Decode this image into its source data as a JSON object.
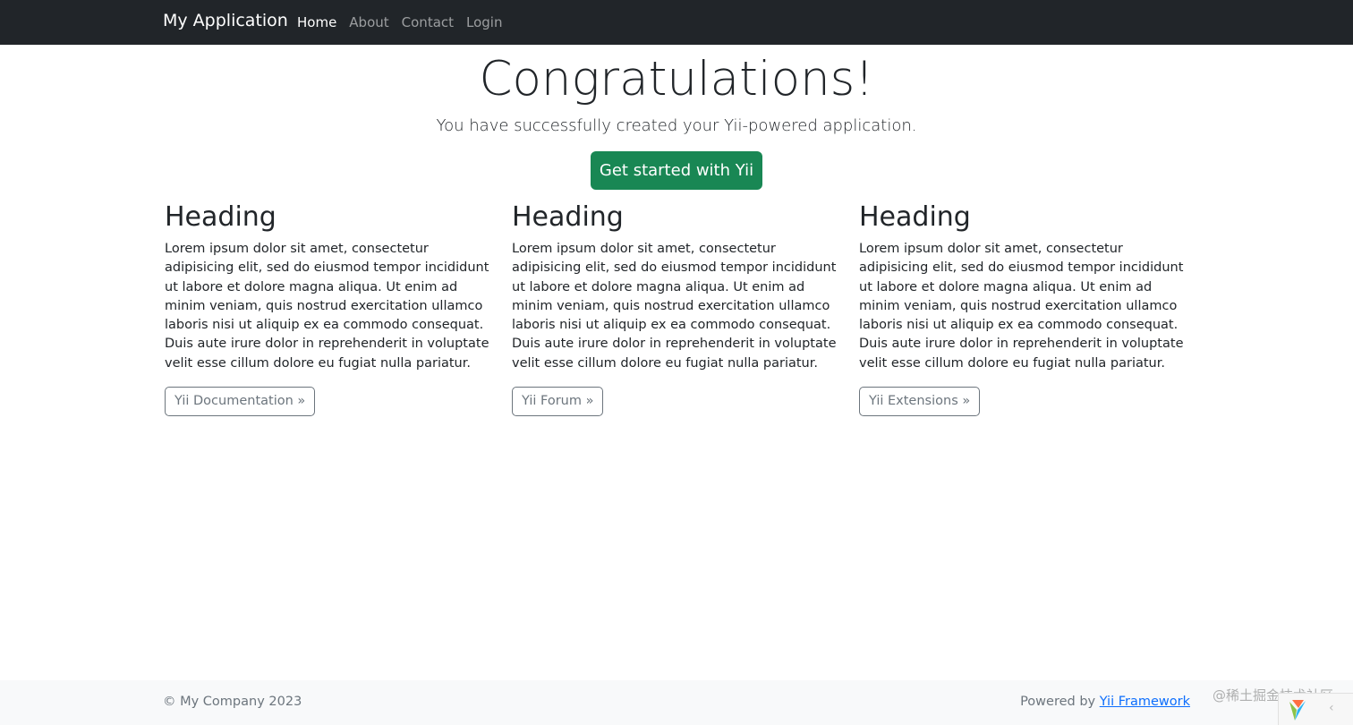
{
  "navbar": {
    "brand": "My Application",
    "links": [
      {
        "label": "Home",
        "active": true
      },
      {
        "label": "About",
        "active": false
      },
      {
        "label": "Contact",
        "active": false
      },
      {
        "label": "Login",
        "active": false
      }
    ]
  },
  "hero": {
    "title": "Congratulations!",
    "lead": "You have successfully created your Yii-powered application.",
    "button_label": "Get started with Yii"
  },
  "columns": [
    {
      "heading": "Heading",
      "text": "Lorem ipsum dolor sit amet, consectetur adipisicing elit, sed do eiusmod tempor incididunt ut labore et dolore magna aliqua. Ut enim ad minim veniam, quis nostrud exercitation ullamco laboris nisi ut aliquip ex ea commodo consequat. Duis aute irure dolor in reprehenderit in voluptate velit esse cillum dolore eu fugiat nulla pariatur.",
      "button_label": "Yii Documentation »"
    },
    {
      "heading": "Heading",
      "text": "Lorem ipsum dolor sit amet, consectetur adipisicing elit, sed do eiusmod tempor incididunt ut labore et dolore magna aliqua. Ut enim ad minim veniam, quis nostrud exercitation ullamco laboris nisi ut aliquip ex ea commodo consequat. Duis aute irure dolor in reprehenderit in voluptate velit esse cillum dolore eu fugiat nulla pariatur.",
      "button_label": "Yii Forum »"
    },
    {
      "heading": "Heading",
      "text": "Lorem ipsum dolor sit amet, consectetur adipisicing elit, sed do eiusmod tempor incididunt ut labore et dolore magna aliqua. Ut enim ad minim veniam, quis nostrud exercitation ullamco laboris nisi ut aliquip ex ea commodo consequat. Duis aute irure dolor in reprehenderit in voluptate velit esse cillum dolore eu fugiat nulla pariatur.",
      "button_label": "Yii Extensions »"
    }
  ],
  "footer": {
    "copyright": "© My Company 2023",
    "powered_prefix": "Powered by ",
    "powered_link": "Yii Framework"
  },
  "watermark": "@稀土掘金技术社区",
  "debug_toolbar": {
    "logo_icon": "yii-logo-icon",
    "toggle_icon": "chevron-left-icon",
    "toggle_glyph": "‹"
  },
  "colors": {
    "navbar_bg": "#212529",
    "primary_success": "#198754",
    "secondary": "#6c757d",
    "link": "#0d6efd",
    "footer_bg": "#f8f9fa"
  }
}
